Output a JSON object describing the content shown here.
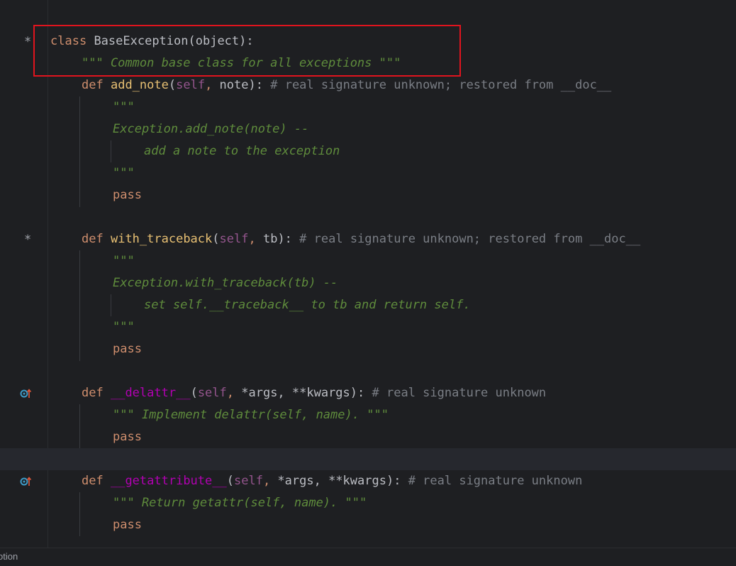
{
  "editor": {
    "lines": {
      "l1": {
        "marker": "*",
        "kw": "class",
        "name": "BaseException",
        "rest": "(object):"
      },
      "l2": {
        "doc": "\"\"\" Common base class for all exceptions \"\"\""
      },
      "l3": {
        "kw": "def",
        "name": "add_note",
        "open": "(",
        "self": "self",
        ",": ", ",
        "param": "note",
        "close": "):",
        "comment": "# real signature unknown; restored from __doc__"
      },
      "l4": {
        "doc": "\"\"\""
      },
      "l5": {
        "doc": "Exception.add_note(note) --"
      },
      "l6": {
        "doc": "add a note to the exception"
      },
      "l7": {
        "doc": "\"\"\""
      },
      "l8": {
        "kw": "pass"
      },
      "l9": {
        "marker": "*",
        "kw": "def",
        "name": "with_traceback",
        "open": "(",
        "self": "self",
        "comma": ", ",
        "param": "tb",
        "close": "):",
        "comment": "# real signature unknown; restored from __doc__"
      },
      "l10": {
        "doc": "\"\"\""
      },
      "l11": {
        "doc": "Exception.with_traceback(tb) --"
      },
      "l12": {
        "doc": "set self.__traceback__ to tb and return self."
      },
      "l13": {
        "doc": "\"\"\""
      },
      "l14": {
        "kw": "pass"
      },
      "l15": {
        "kw": "def",
        "name": "__delattr__",
        "open": "(",
        "self": "self",
        "comma": ", ",
        "param": "*args, **kwargs",
        "close": "):",
        "comment": "# real signature unknown"
      },
      "l16": {
        "doc": "\"\"\" Implement delattr(self, name). \"\"\""
      },
      "l17": {
        "kw": "pass"
      },
      "l18": {
        "kw": "def",
        "name": "__getattribute__",
        "open": "(",
        "self": "self",
        "comma": ", ",
        "param": "*args, **kwargs",
        "close": "):",
        "comment": "# real signature unknown"
      },
      "l19": {
        "doc": "\"\"\" Return getattr(self, name). \"\"\""
      },
      "l20": {
        "kw": "pass"
      }
    }
  },
  "statusbar": {
    "text": "otion"
  },
  "colors": {
    "highlight": "#e0141e",
    "keyword": "#cf8e6d",
    "function": "#e8c073",
    "dunder": "#b200b2",
    "self": "#94558d",
    "docstring": "#5f8c3c",
    "comment": "#7a7e85"
  },
  "icons": {
    "override": "override-up-arrow-icon"
  }
}
